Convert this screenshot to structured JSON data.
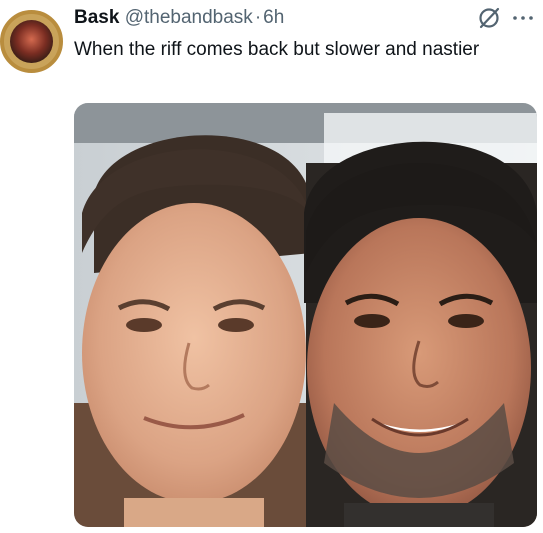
{
  "post": {
    "display_name": "Bask",
    "handle": "@thebandbask",
    "separator": "·",
    "time": "6h",
    "text": "When the riff comes back but slower and nastier"
  },
  "icons": {
    "grok": "grok-icon",
    "more": "more-icon",
    "avatar": "avatar"
  },
  "media": {
    "kind": "photo",
    "subject": "two faces side by side"
  },
  "colors": {
    "text_primary": "#0f1419",
    "text_secondary": "#536471"
  }
}
